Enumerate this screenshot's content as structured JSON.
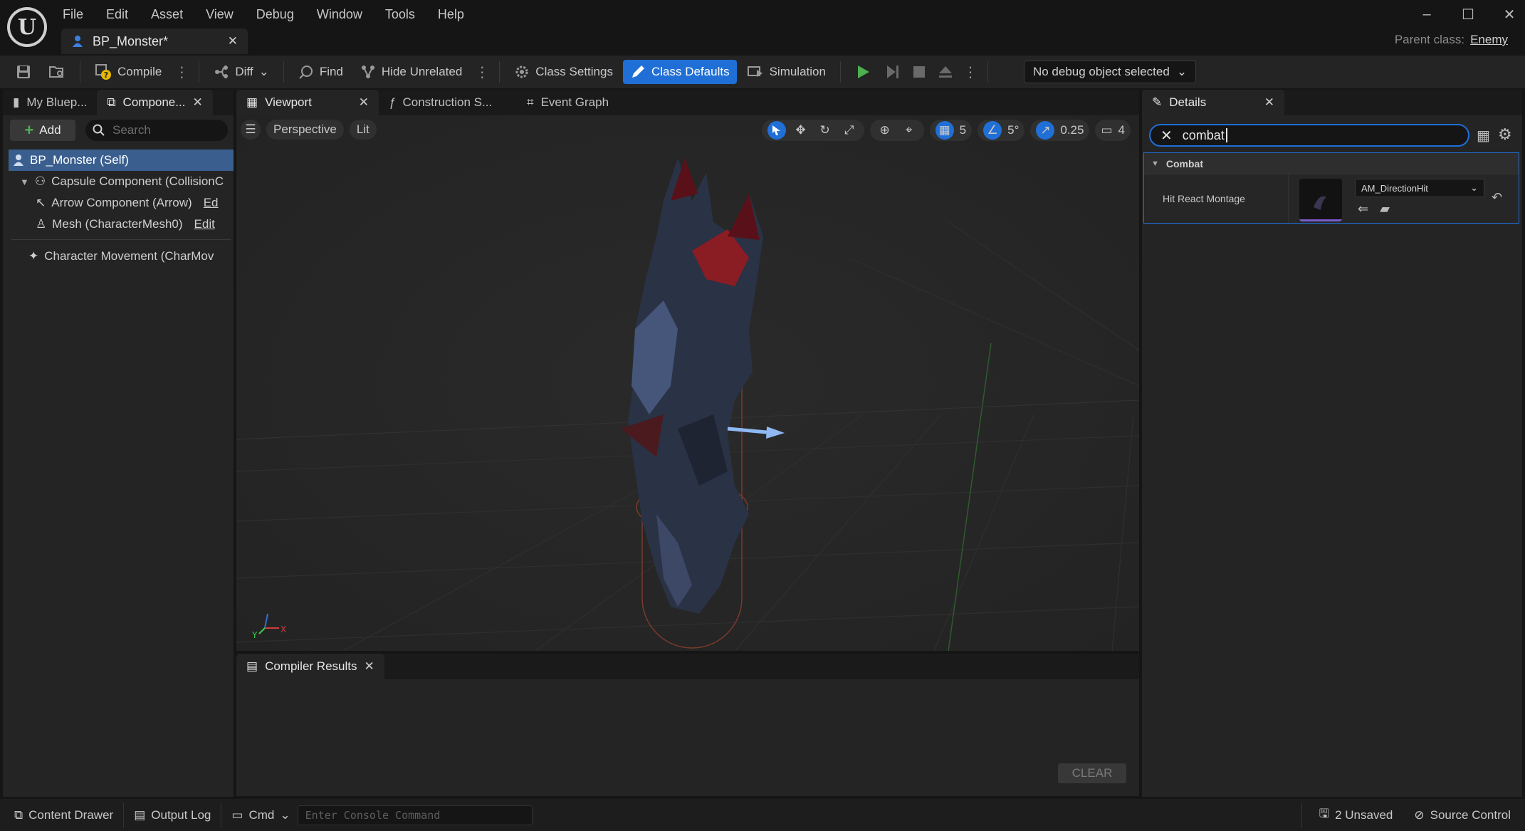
{
  "menu": [
    "File",
    "Edit",
    "Asset",
    "View",
    "Debug",
    "Window",
    "Tools",
    "Help"
  ],
  "document_tab": {
    "label": "BP_Monster*"
  },
  "parent_class": {
    "label": "Parent class:",
    "value": "Enemy"
  },
  "toolbar": {
    "compile": "Compile",
    "diff": "Diff",
    "find": "Find",
    "hide_unrelated": "Hide Unrelated",
    "class_settings": "Class Settings",
    "class_defaults": "Class Defaults",
    "simulation": "Simulation",
    "debug_selector": "No debug object selected"
  },
  "left_panel": {
    "tabs": [
      "My Bluep...",
      "Compone..."
    ],
    "add_label": "Add",
    "search_placeholder": "Search",
    "tree": [
      {
        "label": "BP_Monster (Self)"
      },
      {
        "label": "Capsule Component (CollisionC"
      },
      {
        "label": "Arrow Component (Arrow)",
        "edit": "Ed"
      },
      {
        "label": "Mesh (CharacterMesh0)",
        "edit": "Edit"
      },
      {
        "label": "Character Movement (CharMov"
      }
    ]
  },
  "center_tabs": [
    "Viewport",
    "Construction S...",
    "Event Graph"
  ],
  "viewport": {
    "perspective": "Perspective",
    "lit": "Lit",
    "grid_snap": "5",
    "rotation_snap": "5°",
    "scale_snap": "0.25",
    "camera_speed": "4",
    "axis_labels": {
      "x": "X",
      "y": "Y"
    }
  },
  "compiler": {
    "tab": "Compiler Results",
    "clear": "CLEAR"
  },
  "details": {
    "tab": "Details",
    "search_value": "combat",
    "category": "Combat",
    "property_name": "Hit React Montage",
    "property_value": "AM_DirectionHit"
  },
  "statusbar": {
    "content_drawer": "Content Drawer",
    "output_log": "Output Log",
    "cmd": "Cmd",
    "console_placeholder": "Enter Console Command",
    "unsaved": "2 Unsaved",
    "source_control": "Source Control"
  },
  "colors": {
    "accent": "#1f6fd6",
    "selection": "#3a5f8f",
    "play_green": "#4caf50"
  }
}
